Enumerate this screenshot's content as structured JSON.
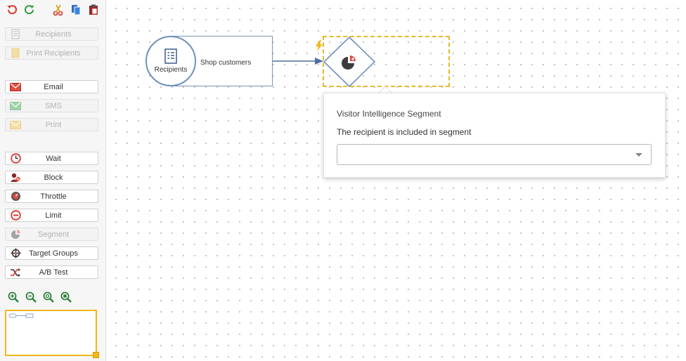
{
  "sidebar": {
    "buttons": [
      {
        "id": "recipients",
        "label": "Recipients",
        "icon": "recipients-list-icon",
        "disabled": true
      },
      {
        "id": "print-recipients",
        "label": "Print Recipients",
        "icon": "print-recipients-icon",
        "disabled": true
      },
      {
        "id": "email",
        "label": "Email",
        "icon": "email-icon",
        "disabled": false
      },
      {
        "id": "sms",
        "label": "SMS",
        "icon": "sms-icon",
        "disabled": true
      },
      {
        "id": "print",
        "label": "Print",
        "icon": "print-icon",
        "disabled": true
      },
      {
        "id": "wait",
        "label": "Wait",
        "icon": "clock-icon",
        "disabled": false
      },
      {
        "id": "block",
        "label": "Block",
        "icon": "block-icon",
        "disabled": false
      },
      {
        "id": "throttle",
        "label": "Throttle",
        "icon": "throttle-icon",
        "disabled": false
      },
      {
        "id": "limit",
        "label": "Limit",
        "icon": "limit-icon",
        "disabled": false
      },
      {
        "id": "segment",
        "label": "Segment",
        "icon": "segment-icon",
        "disabled": true
      },
      {
        "id": "target-groups",
        "label": "Target Groups",
        "icon": "crosshair-icon",
        "disabled": false
      },
      {
        "id": "ab-test",
        "label": "A/B Test",
        "icon": "shuffle-icon",
        "disabled": false
      }
    ]
  },
  "toolbar": {
    "icons": [
      "undo-icon",
      "redo-icon",
      "cut-icon",
      "copy-icon",
      "paste-icon"
    ]
  },
  "zoom": {
    "icons": [
      "zoom-in-icon",
      "zoom-out-icon",
      "zoom-reset-icon",
      "zoom-fit-icon"
    ]
  },
  "canvas": {
    "recipients_node": {
      "label": "Recipients",
      "text": "Shop customers"
    },
    "segment_node": {
      "icon": "segment-icon"
    }
  },
  "popup": {
    "title": "Visitor Intelligence Segment",
    "subtitle": "The recipient is included in segment",
    "select_value": ""
  },
  "colors": {
    "accent": "#f0b61b",
    "node_border": "#6e8fbf",
    "email_red": "#d9342b",
    "dark_icon": "#444444"
  }
}
